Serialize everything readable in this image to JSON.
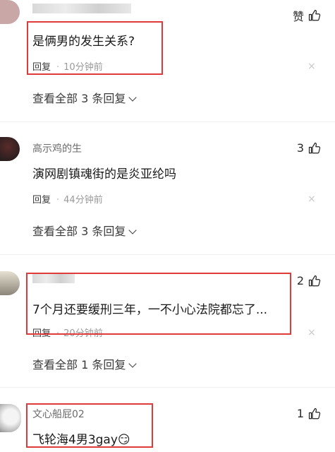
{
  "comments": [
    {
      "username": "",
      "text": "是俩男的发生关系?",
      "reply_label": "回复",
      "time": "10分钟前",
      "like_label": "赞",
      "view_all": "查看全部 3 条回复"
    },
    {
      "username": "高示鸡的生",
      "text": "演网剧镇魂街的是炎亚纶吗",
      "reply_label": "回复",
      "time": "44分钟前",
      "like_count": "3",
      "view_all": "查看全部 3 条回复"
    },
    {
      "username": "",
      "text": "7个月还要缓刑三年，一不小心法院都忘了...",
      "reply_label": "回复",
      "time": "20分钟前",
      "like_count": "2",
      "view_all": "查看全部 1 条回复"
    },
    {
      "username": "文心船屁02",
      "text": "飞轮海4男3gay",
      "emoji": "😏",
      "like_count": "1"
    }
  ],
  "close_symbol": "×",
  "colors": {
    "highlight": "#e03b3b"
  }
}
